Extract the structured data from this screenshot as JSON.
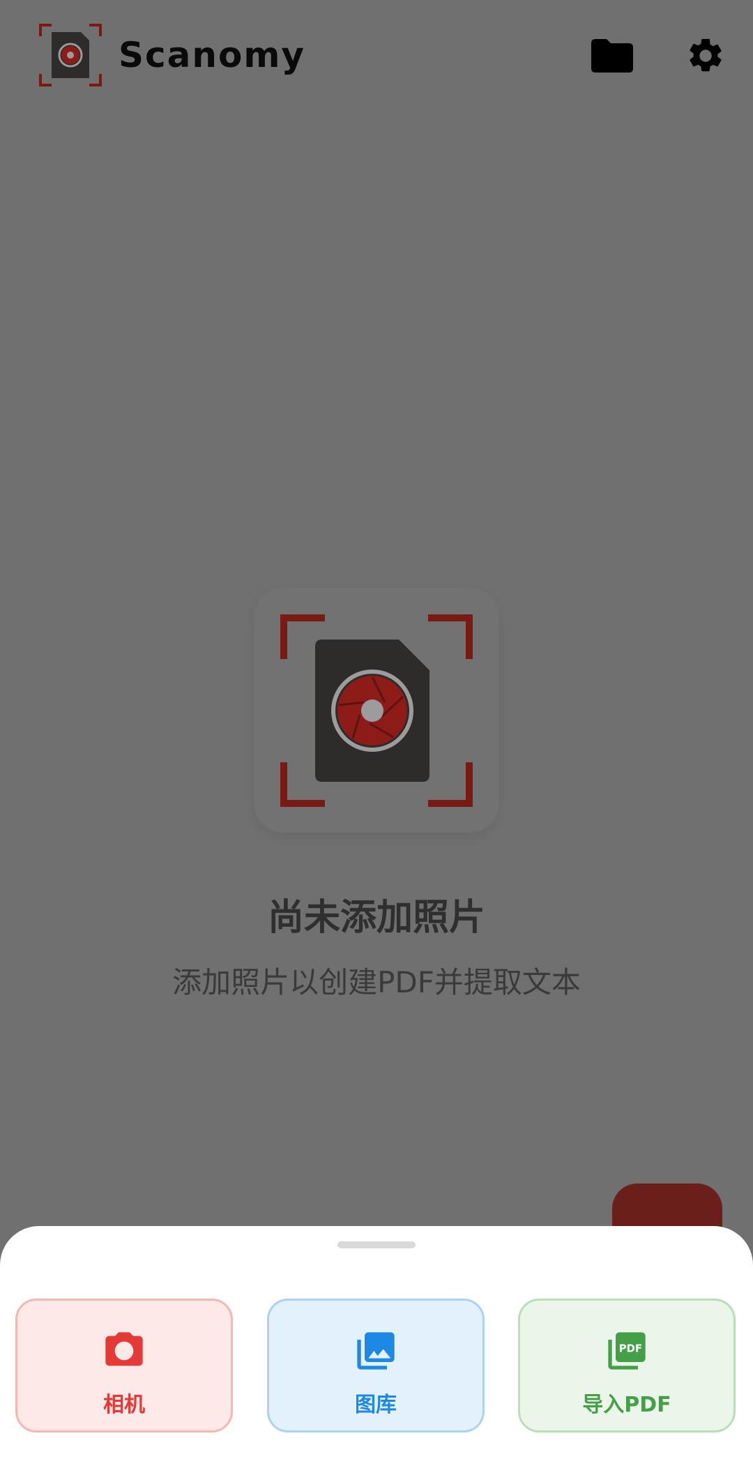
{
  "header": {
    "app_title": "Scanomy",
    "logo_icon": "document-camera-logo-icon",
    "actions": [
      {
        "name": "folder",
        "icon": "folder-icon"
      },
      {
        "name": "settings",
        "icon": "gear-icon"
      }
    ]
  },
  "empty_state": {
    "illustration_icon": "document-camera-logo-icon",
    "title": "尚未添加照片",
    "subtitle": "添加照片以创建PDF并提取文本"
  },
  "bottom_sheet": {
    "actions": [
      {
        "label": "相机",
        "icon": "camera-icon",
        "color": "#e53935",
        "background": "#fde9e7"
      },
      {
        "label": "图库",
        "icon": "photo-library-icon",
        "color": "#1e88e5",
        "background": "#e3f1fc"
      },
      {
        "label": "导入PDF",
        "icon": "pdf-icon",
        "color": "#43a047",
        "background": "#ebf5ea"
      }
    ]
  },
  "colors": {
    "brand_dark_red": "#6b1f1a",
    "frame_red": "#7a1a14",
    "scrim": "#707070"
  }
}
